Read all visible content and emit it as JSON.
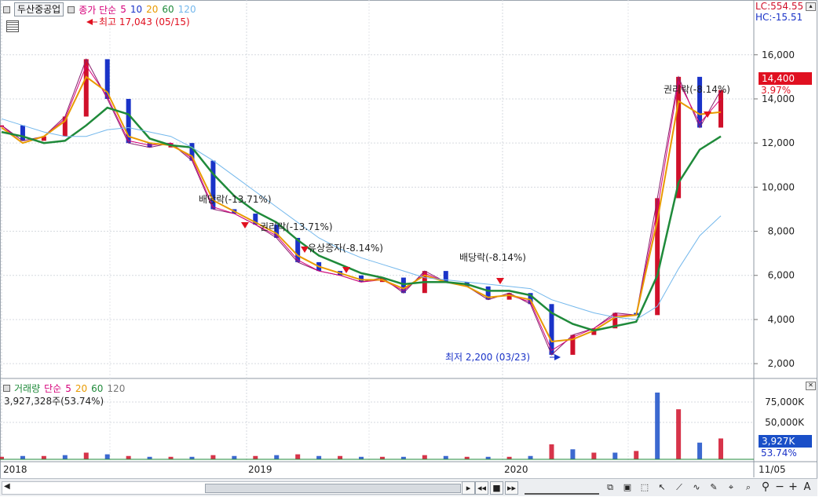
{
  "price_header": {
    "name": "두산중공업",
    "ma_title": "종가 단순",
    "ma_periods": [
      "5",
      "10",
      "20",
      "60",
      "120"
    ],
    "ma_colors": [
      "#d6007a",
      "#1a33c8",
      "#e89a00",
      "#1f8a3a",
      "#74b8ec"
    ]
  },
  "volume_header": {
    "title": "거래량",
    "ma_title": "단순",
    "ma_periods": [
      "5",
      "20",
      "60",
      "120"
    ],
    "ma_colors": [
      "#d6007a",
      "#e89a00",
      "#1f8a3a",
      "#777777"
    ],
    "value_text": "3,927,328주(53.74%)"
  },
  "right_info": {
    "lc": "LC:554.55",
    "hc": "HC:-15.51"
  },
  "price_tag": {
    "value": "14,400",
    "pct": "3.97%"
  },
  "volume_tag": {
    "value": "3,927K",
    "pct": "53.74%"
  },
  "annotations": {
    "high": "최고 17,043 (05/15)",
    "low": "최저 2,200 (03/23)",
    "dividend1": "배당락(-13.71%)",
    "rights1": "권리락(-13.71%)",
    "paid_in": "유상증자(-8.14%)",
    "dividend2": "배당락(-8.14%)",
    "rights2": "권리락(-8.14%)"
  },
  "chart_data": {
    "type": "line",
    "title": "두산중공업",
    "price_axis": {
      "ticks": [
        "16,000",
        "14,000",
        "12,000",
        "10,000",
        "8,000",
        "6,000",
        "4,000",
        "2,000"
      ],
      "ylim": [
        1400,
        17700
      ]
    },
    "volume_axis": {
      "ticks": [
        "75,000K",
        "50,000K"
      ]
    },
    "x_labels": [
      "2018",
      "2019",
      "2020",
      "11/05"
    ],
    "x": [
      "2018-01",
      "2018-02",
      "2018-03",
      "2018-04",
      "2018-05",
      "2018-06",
      "2018-07",
      "2018-08",
      "2018-09",
      "2018-10",
      "2018-11",
      "2018-12",
      "2019-01",
      "2019-02",
      "2019-03",
      "2019-04",
      "2019-05",
      "2019-06",
      "2019-07",
      "2019-08",
      "2019-09",
      "2019-10",
      "2019-11",
      "2019-12",
      "2020-01",
      "2020-02",
      "2020-03",
      "2020-04",
      "2020-05",
      "2020-06",
      "2020-07",
      "2020-08",
      "2020-09",
      "2020-10",
      "2020-11"
    ],
    "series": [
      {
        "name": "종가",
        "values": [
          12800,
          12100,
          12300,
          13200,
          15800,
          14000,
          12000,
          11800,
          12000,
          11200,
          9000,
          8800,
          8300,
          7700,
          6600,
          6200,
          6000,
          5700,
          5900,
          5200,
          6200,
          5700,
          5500,
          4900,
          5200,
          4700,
          2400,
          3300,
          3600,
          4300,
          4200,
          9500,
          15000,
          12700,
          14400
        ]
      },
      {
        "name": "5",
        "values": [
          12800,
          12000,
          12300,
          13100,
          15500,
          14100,
          12100,
          11900,
          12000,
          11300,
          9100,
          8800,
          8300,
          7800,
          6700,
          6200,
          6000,
          5700,
          5800,
          5300,
          6100,
          5700,
          5500,
          5000,
          5100,
          4800,
          2600,
          3200,
          3600,
          4200,
          4200,
          9000,
          14800,
          12900,
          14000
        ]
      },
      {
        "name": "20",
        "values": [
          12700,
          12000,
          12300,
          13000,
          15000,
          14300,
          12300,
          12000,
          11900,
          11400,
          9400,
          8900,
          8400,
          7900,
          6900,
          6400,
          6100,
          5800,
          5800,
          5400,
          6000,
          5700,
          5500,
          5000,
          5100,
          4900,
          3000,
          3100,
          3500,
          4100,
          4200,
          8500,
          13900,
          13300,
          13400
        ]
      },
      {
        "name": "60",
        "values": [
          12500,
          12300,
          12000,
          12100,
          12800,
          13600,
          13300,
          12200,
          11900,
          11800,
          10600,
          9600,
          8900,
          8400,
          7600,
          6900,
          6500,
          6100,
          5900,
          5600,
          5700,
          5700,
          5600,
          5300,
          5300,
          5100,
          4300,
          3800,
          3500,
          3700,
          3900,
          6000,
          10200,
          11700,
          12300
        ]
      },
      {
        "name": "120",
        "values": [
          13100,
          12800,
          12500,
          12300,
          12300,
          12600,
          12700,
          12500,
          12300,
          11800,
          11200,
          10500,
          9800,
          9100,
          8400,
          7700,
          7200,
          6800,
          6500,
          6200,
          5900,
          5800,
          5700,
          5600,
          5500,
          5400,
          4900,
          4600,
          4300,
          4100,
          4000,
          4600,
          6300,
          7800,
          8700
        ]
      }
    ],
    "volume": {
      "name": "거래량",
      "values": [
        3,
        4,
        4,
        5,
        8,
        6,
        4,
        3,
        3,
        3,
        5,
        4,
        4,
        5,
        6,
        4,
        4,
        3,
        3,
        3,
        5,
        4,
        3,
        3,
        3,
        4,
        18,
        12,
        8,
        8,
        10,
        80,
        60,
        20,
        25
      ],
      "unit": "000K"
    }
  }
}
